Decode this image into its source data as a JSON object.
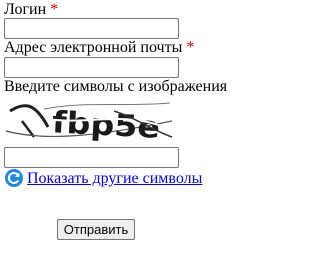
{
  "form": {
    "login": {
      "label": "Логин",
      "required_mark": "*",
      "value": ""
    },
    "email": {
      "label": "Адрес электронной почты",
      "required_mark": "*",
      "value": ""
    },
    "captcha": {
      "label": "Введите символы с изображения",
      "image_text": "fbp5e",
      "value": ""
    },
    "refresh_link": {
      "label": "Показать другие символы",
      "icon": "refresh-icon"
    },
    "submit_label": "Отправить"
  },
  "colors": {
    "required": "#cc0000",
    "link": "#0000ee",
    "refresh_icon": "#1e88e5"
  }
}
